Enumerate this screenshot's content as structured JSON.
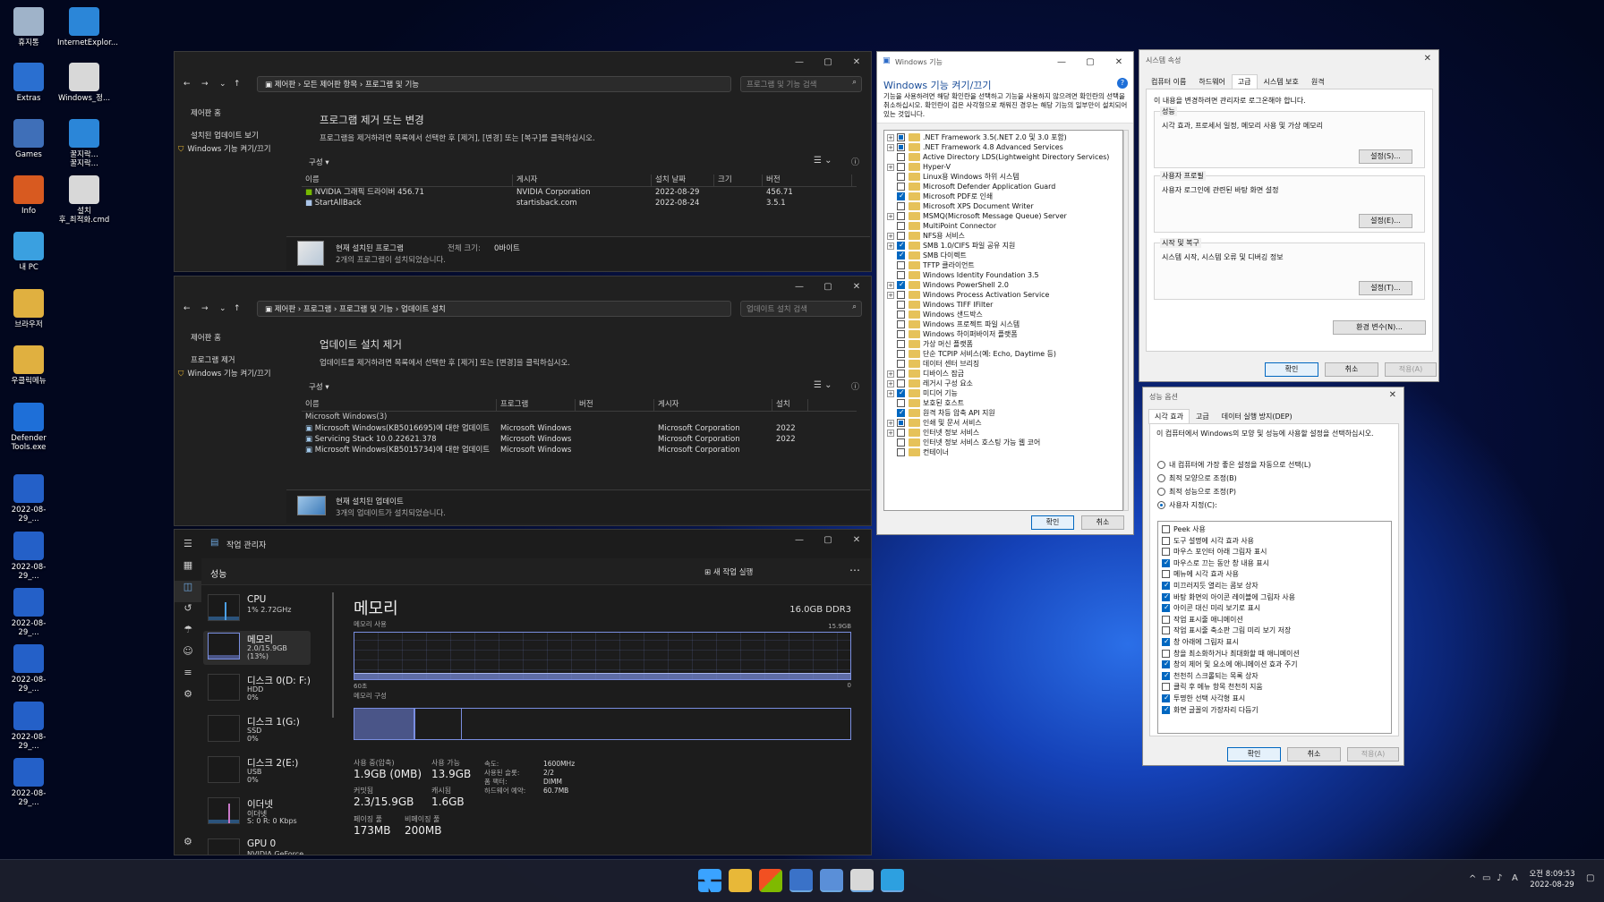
{
  "desktop_icons": [
    {
      "label": "휴지통",
      "color": "#9fb3c9"
    },
    {
      "label": "InternetExplor...",
      "color": "#2b86d8"
    },
    {
      "label": "Extras",
      "color": "#2a6fd0"
    },
    {
      "label": "Windows_정...",
      "color": "#d8d8d8"
    },
    {
      "label": "Games",
      "color": "#3f6fb8"
    },
    {
      "label": "꿀지락...\n꿀지락...",
      "color": "#2b86d8"
    },
    {
      "label": "Info",
      "color": "#d85a20"
    },
    {
      "label": "설치\n후_최적화.cmd",
      "color": "#d8d8d8"
    },
    {
      "label": "내 PC",
      "color": "#3aa0e0"
    },
    {
      "label": "브라우저",
      "color": "#e0b040"
    },
    {
      "label": "우클릭메뉴",
      "color": "#e0b040"
    },
    {
      "label": "Defender\nTools.exe",
      "color": "#1e6fd8"
    },
    {
      "label": "2022-08-29_...",
      "color": "#2460c8"
    },
    {
      "label": "2022-08-29_...",
      "color": "#2460c8"
    },
    {
      "label": "2022-08-29_...",
      "color": "#2460c8"
    },
    {
      "label": "2022-08-29_...",
      "color": "#2460c8"
    },
    {
      "label": "2022-08-29_...",
      "color": "#2460c8"
    },
    {
      "label": "2022-08-29_...",
      "color": "#2460c8"
    }
  ],
  "programs": {
    "address": "제어판 › 모든 제어판 항목 › 프로그램 및 기능",
    "search_placeholder": "프로그램 및 기능 검색",
    "left_nav": [
      "제어판 홈",
      "설치된 업데이트 보기",
      "Windows 기능 켜기/끄기"
    ],
    "title": "프로그램 제거 또는 변경",
    "desc": "프로그램을 제거하려면 목록에서 선택한 후 [제거], [변경] 또는 [복구]를 클릭하십시오.",
    "organize": "구성 ▾",
    "columns": [
      "이름",
      "게시자",
      "설치 날짜",
      "크기",
      "버전"
    ],
    "rows": [
      {
        "name": "NVIDIA 그래픽 드라이버 456.71",
        "publisher": "NVIDIA Corporation",
        "date": "2022-08-29",
        "size": "",
        "version": "456.71"
      },
      {
        "name": "StartAllBack",
        "publisher": "startisback.com",
        "date": "2022-08-24",
        "size": "",
        "version": "3.5.1"
      }
    ],
    "footer_title": "현재 설치된 프로그램",
    "footer_size_label": "전체 크기:",
    "footer_size": "0바이트",
    "footer_count": "2개의 프로그램이 설치되었습니다."
  },
  "updates": {
    "address": "제어판 › 프로그램 › 프로그램 및 기능 › 업데이트 설치",
    "search_placeholder": "업데이트 설치 검색",
    "left_nav": [
      "제어판 홈",
      "프로그램 제거",
      "Windows 기능 켜기/끄기"
    ],
    "title": "업데이트 설치 제거",
    "desc": "업데이트를 제거하려면 목록에서 선택한 후 [제거] 또는 [변경]을 클릭하십시오.",
    "organize": "구성 ▾",
    "columns": [
      "이름",
      "프로그램",
      "버전",
      "게시자",
      "설치"
    ],
    "group": "Microsoft Windows(3)",
    "rows": [
      {
        "name": "Microsoft Windows(KB5016695)에 대한 업데이트",
        "program": "Microsoft Windows",
        "version": "",
        "publisher": "Microsoft Corporation",
        "date": "2022"
      },
      {
        "name": "Servicing Stack 10.0.22621.378",
        "program": "Microsoft Windows",
        "version": "",
        "publisher": "Microsoft Corporation",
        "date": "2022"
      },
      {
        "name": "Microsoft Windows(KB5015734)에 대한 업데이트",
        "program": "Microsoft Windows",
        "version": "",
        "publisher": "Microsoft Corporation",
        "date": ""
      }
    ],
    "footer_title": "현재 설치된 업데이트",
    "footer_count": "3개의 업데이트가 설치되었습니다."
  },
  "features": {
    "window_title": "Windows 기능",
    "heading": "Windows 기능 켜기/끄기",
    "desc": "기능을 사용하려면 해당 확인란을 선택하고 기능을 사용하지 않으려면 확인란의 선택을 취소하십시오. 확인란이 검은 사각형으로 채워진 경우는 해당 기능의 일부만이 설치되어 있는 것입니다.",
    "items": [
      {
        "label": ".NET Framework 3.5(.NET 2.0 및 3.0 포함)",
        "expand": true,
        "state": "partial"
      },
      {
        "label": ".NET Framework 4.8 Advanced Services",
        "expand": true,
        "state": "partial"
      },
      {
        "label": "Active Directory LDS(Lightweight Directory Services)",
        "expand": false,
        "state": "off"
      },
      {
        "label": "Hyper-V",
        "expand": true,
        "state": "off"
      },
      {
        "label": "Linux용 Windows 하위 시스템",
        "expand": false,
        "state": "off"
      },
      {
        "label": "Microsoft Defender Application Guard",
        "expand": false,
        "state": "off"
      },
      {
        "label": "Microsoft PDF로 인쇄",
        "expand": false,
        "state": "on"
      },
      {
        "label": "Microsoft XPS Document Writer",
        "expand": false,
        "state": "off"
      },
      {
        "label": "MSMQ(Microsoft Message Queue) Server",
        "expand": true,
        "state": "off"
      },
      {
        "label": "MultiPoint Connector",
        "expand": false,
        "state": "off"
      },
      {
        "label": "NFS용 서비스",
        "expand": true,
        "state": "off"
      },
      {
        "label": "SMB 1.0/CIFS 파일 공유 지원",
        "expand": true,
        "state": "on"
      },
      {
        "label": "SMB 다이렉트",
        "expand": false,
        "state": "on"
      },
      {
        "label": "TFTP 클라이언트",
        "expand": false,
        "state": "off"
      },
      {
        "label": "Windows Identity Foundation 3.5",
        "expand": false,
        "state": "off"
      },
      {
        "label": "Windows PowerShell 2.0",
        "expand": true,
        "state": "on"
      },
      {
        "label": "Windows Process Activation Service",
        "expand": true,
        "state": "off"
      },
      {
        "label": "Windows TIFF IFilter",
        "expand": false,
        "state": "off"
      },
      {
        "label": "Windows 샌드박스",
        "expand": false,
        "state": "off"
      },
      {
        "label": "Windows 프로젝트 파일 시스템",
        "expand": false,
        "state": "off"
      },
      {
        "label": "Windows 하이퍼바이저 플랫폼",
        "expand": false,
        "state": "off"
      },
      {
        "label": "가상 머신 플랫폼",
        "expand": false,
        "state": "off"
      },
      {
        "label": "단순 TCPIP 서비스(예: Echo, Daytime 등)",
        "expand": false,
        "state": "off"
      },
      {
        "label": "데이터 센터 브리징",
        "expand": false,
        "state": "off"
      },
      {
        "label": "디바이스 잠금",
        "expand": true,
        "state": "off"
      },
      {
        "label": "레거시 구성 요소",
        "expand": true,
        "state": "off"
      },
      {
        "label": "미디어 기능",
        "expand": true,
        "state": "on"
      },
      {
        "label": "보호된 호스트",
        "expand": false,
        "state": "off"
      },
      {
        "label": "원격 차등 압축 API 지원",
        "expand": false,
        "state": "on"
      },
      {
        "label": "인쇄 및 문서 서비스",
        "expand": true,
        "state": "partial"
      },
      {
        "label": "인터넷 정보 서비스",
        "expand": true,
        "state": "off"
      },
      {
        "label": "인터넷 정보 서비스 호스팅 가능 웹 코어",
        "expand": false,
        "state": "off"
      },
      {
        "label": "컨테이너",
        "expand": false,
        "state": "off"
      }
    ],
    "ok": "확인",
    "cancel": "취소"
  },
  "sysprops": {
    "window_title": "시스템 속성",
    "tabs": [
      "컴퓨터 이름",
      "하드웨어",
      "고급",
      "시스템 보호",
      "원격"
    ],
    "selected_tab": 2,
    "admin_note": "이 내용을 변경하려면 관리자로 로그온해야 합니다.",
    "groups": [
      {
        "title": "성능",
        "desc": "시각 효과, 프로세서 일정, 메모리 사용 및 가상 메모리",
        "button": "설정(S)..."
      },
      {
        "title": "사용자 프로필",
        "desc": "사용자 로그인에 관련된 바탕 화면 설정",
        "button": "설정(E)..."
      },
      {
        "title": "시작 및 복구",
        "desc": "시스템 시작, 시스템 오류 및 디버깅 정보",
        "button": "설정(T)..."
      }
    ],
    "env_button": "환경 변수(N)...",
    "ok": "확인",
    "cancel": "취소",
    "apply": "적용(A)"
  },
  "perfopts": {
    "window_title": "성능 옵션",
    "tabs": [
      "시각 효과",
      "고급",
      "데이터 실행 방지(DEP)"
    ],
    "desc": "이 컴퓨터에서 Windows의 모양 및 성능에 사용할 설정을 선택하십시오.",
    "radios": [
      {
        "label": "내 컴퓨터에 가장 좋은 설정을 자동으로 선택(L)",
        "on": false
      },
      {
        "label": "최적 모양으로 조정(B)",
        "on": false
      },
      {
        "label": "최적 성능으로 조정(P)",
        "on": false
      },
      {
        "label": "사용자 지정(C):",
        "on": true
      }
    ],
    "options": [
      {
        "label": "Peek 사용",
        "on": false
      },
      {
        "label": "도구 설명에 시각 효과 사용",
        "on": false
      },
      {
        "label": "마우스 포인터 아래 그림자 표시",
        "on": false
      },
      {
        "label": "마우스로 끄는 동안 창 내용 표시",
        "on": true
      },
      {
        "label": "메뉴에 시각 효과 사용",
        "on": false
      },
      {
        "label": "미끄러지듯 열리는 콤보 상자",
        "on": true
      },
      {
        "label": "바탕 화면의 아이콘 레이블에 그림자 사용",
        "on": true
      },
      {
        "label": "아이콘 대신 미리 보기로 표시",
        "on": true
      },
      {
        "label": "작업 표시줄 애니메이션",
        "on": false
      },
      {
        "label": "작업 표시줄 축소판 그림 미리 보기 저장",
        "on": false
      },
      {
        "label": "창 아래에 그림자 표시",
        "on": true
      },
      {
        "label": "창을 최소화하거나 최대화할 때 애니메이션",
        "on": false
      },
      {
        "label": "창의 제어 및 요소에 애니메이션 효과 주기",
        "on": true
      },
      {
        "label": "천천히 스크롤되는 목록 상자",
        "on": true
      },
      {
        "label": "클릭 후 메뉴 항목 천천히 지움",
        "on": false
      },
      {
        "label": "투명한 선택 사각형 표시",
        "on": true
      },
      {
        "label": "화면 글꼴의 가장자리 다듬기",
        "on": true
      }
    ],
    "ok": "확인",
    "cancel": "취소",
    "apply": "적용(A)"
  },
  "taskmgr": {
    "window_title": "작업 관리자",
    "section": "성능",
    "new_task": "새 작업 실행",
    "items": [
      {
        "name": "CPU",
        "s1": "1% 2.72GHz",
        "s2": ""
      },
      {
        "name": "메모리",
        "s1": "2.0/15.9GB (13%)",
        "s2": ""
      },
      {
        "name": "디스크 0(D: F:)",
        "s1": "HDD",
        "s2": "0%"
      },
      {
        "name": "디스크 1(G:)",
        "s1": "SSD",
        "s2": "0%"
      },
      {
        "name": "디스크 2(E:)",
        "s1": "USB",
        "s2": "0%"
      },
      {
        "name": "이더넷",
        "s1": "이더넷",
        "s2": "S: 0 R: 0 Kbps"
      },
      {
        "name": "GPU 0",
        "s1": "NVIDIA GeForce",
        "s2": ""
      }
    ],
    "mem_title": "메모리",
    "mem_total": "16.0GB DDR3",
    "mem_usage_label": "메모리 사용",
    "mem_max": "15.9GB",
    "time_label": "60초",
    "zero": "0",
    "composition_label": "메모리 구성",
    "usage_fraction": 0.13,
    "stats": [
      {
        "label": "사용 중(압축)",
        "value": "1.9GB (0MB)"
      },
      {
        "label": "사용 가능",
        "value": "13.9GB"
      },
      {
        "label": "커밋됨",
        "value": "2.3/15.9GB"
      },
      {
        "label": "캐시됨",
        "value": "1.6GB"
      },
      {
        "label": "페이징 풀",
        "value": "173MB"
      },
      {
        "label": "비페이징 풀",
        "value": "200MB"
      }
    ],
    "details": [
      {
        "label": "속도:",
        "value": "1600MHz"
      },
      {
        "label": "사용된 슬롯:",
        "value": "2/2"
      },
      {
        "label": "폼 팩터:",
        "value": "DIMM"
      },
      {
        "label": "하드웨어 예약:",
        "value": "60.7MB"
      }
    ]
  },
  "tray": {
    "time": "오전 8:09:53",
    "date": "2022-08-29",
    "lang": "A"
  }
}
